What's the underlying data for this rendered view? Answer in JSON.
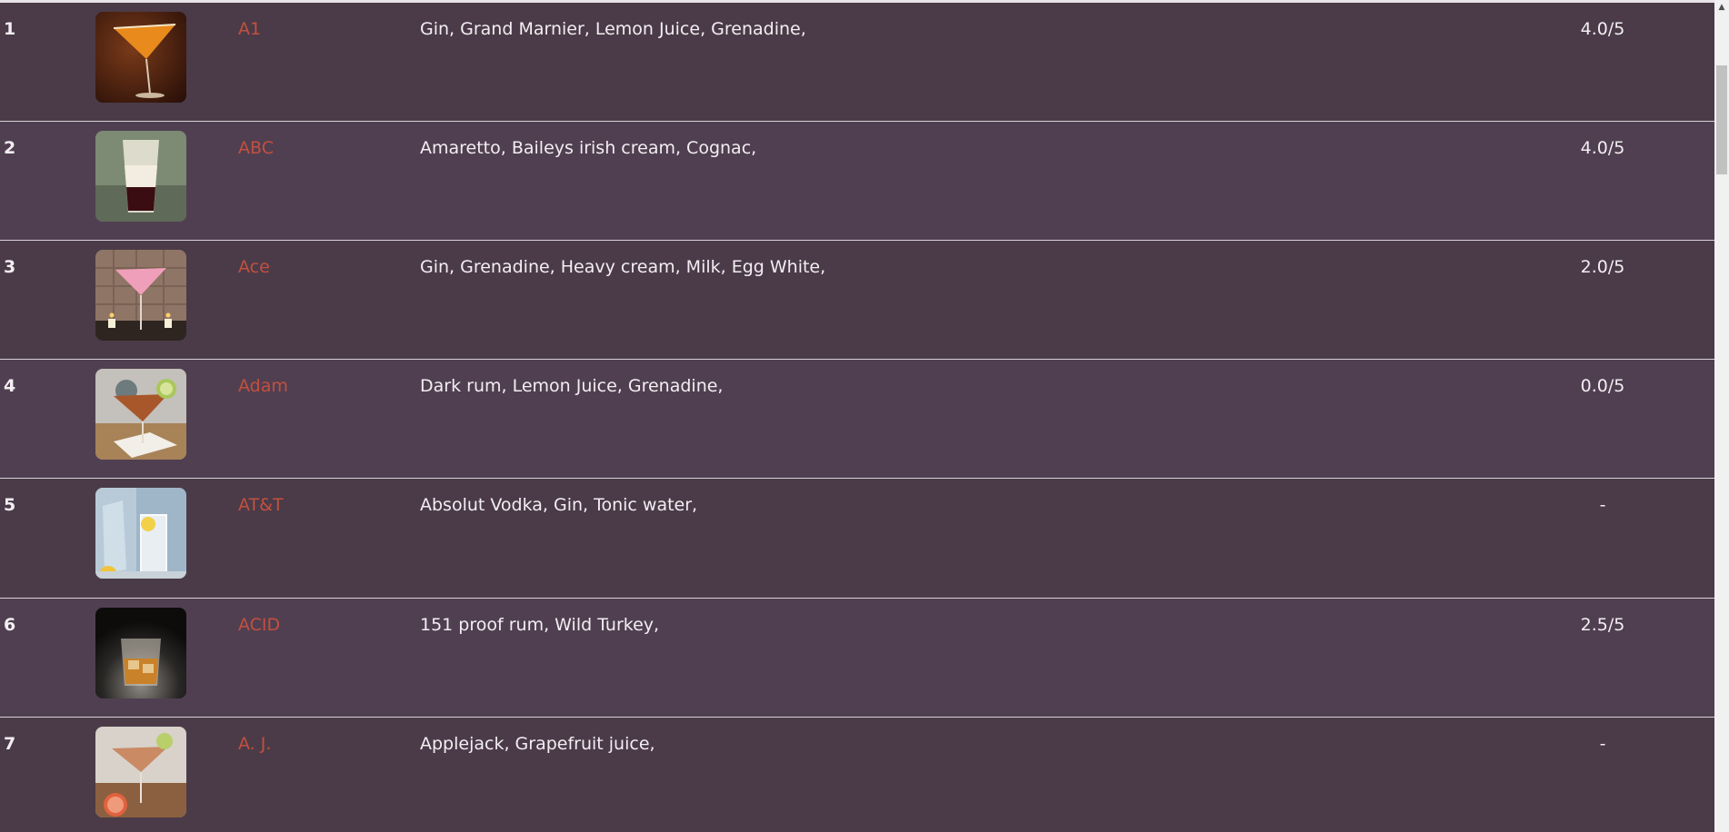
{
  "rows": [
    {
      "rank": "1",
      "name": "A1",
      "ingredients": "Gin, Grand Marnier, Lemon Juice, Grenadine,",
      "rating": "4.0/5",
      "image": "cocktail-orange-martini"
    },
    {
      "rank": "2",
      "name": "ABC",
      "ingredients": "Amaretto, Baileys irish cream, Cognac,",
      "rating": "4.0/5",
      "image": "layered-shot"
    },
    {
      "rank": "3",
      "name": "Ace",
      "ingredients": "Gin, Grenadine, Heavy cream, Milk, Egg White,",
      "rating": "2.0/5",
      "image": "pink-martini-candles"
    },
    {
      "rank": "4",
      "name": "Adam",
      "ingredients": "Dark rum, Lemon Juice, Grenadine,",
      "rating": "0.0/5",
      "image": "amber-martini-lime"
    },
    {
      "rank": "5",
      "name": "AT&T",
      "ingredients": "Absolut Vodka, Gin, Tonic water,",
      "rating": "-",
      "image": "highball-tonic"
    },
    {
      "rank": "6",
      "name": "ACID",
      "ingredients": "151 proof rum, Wild Turkey,",
      "rating": "2.5/5",
      "image": "whiskey-rocks"
    },
    {
      "rank": "7",
      "name": "A. J.",
      "ingredients": "Applejack, Grapefruit juice,",
      "rating": "-",
      "image": "martini-grapefruit"
    }
  ],
  "colors": {
    "background": "#4b3a49",
    "name_link": "#c2503e",
    "text": "#f3eef2"
  },
  "scrollbar": {
    "up_arrow_icon": "arrow-up-icon"
  }
}
